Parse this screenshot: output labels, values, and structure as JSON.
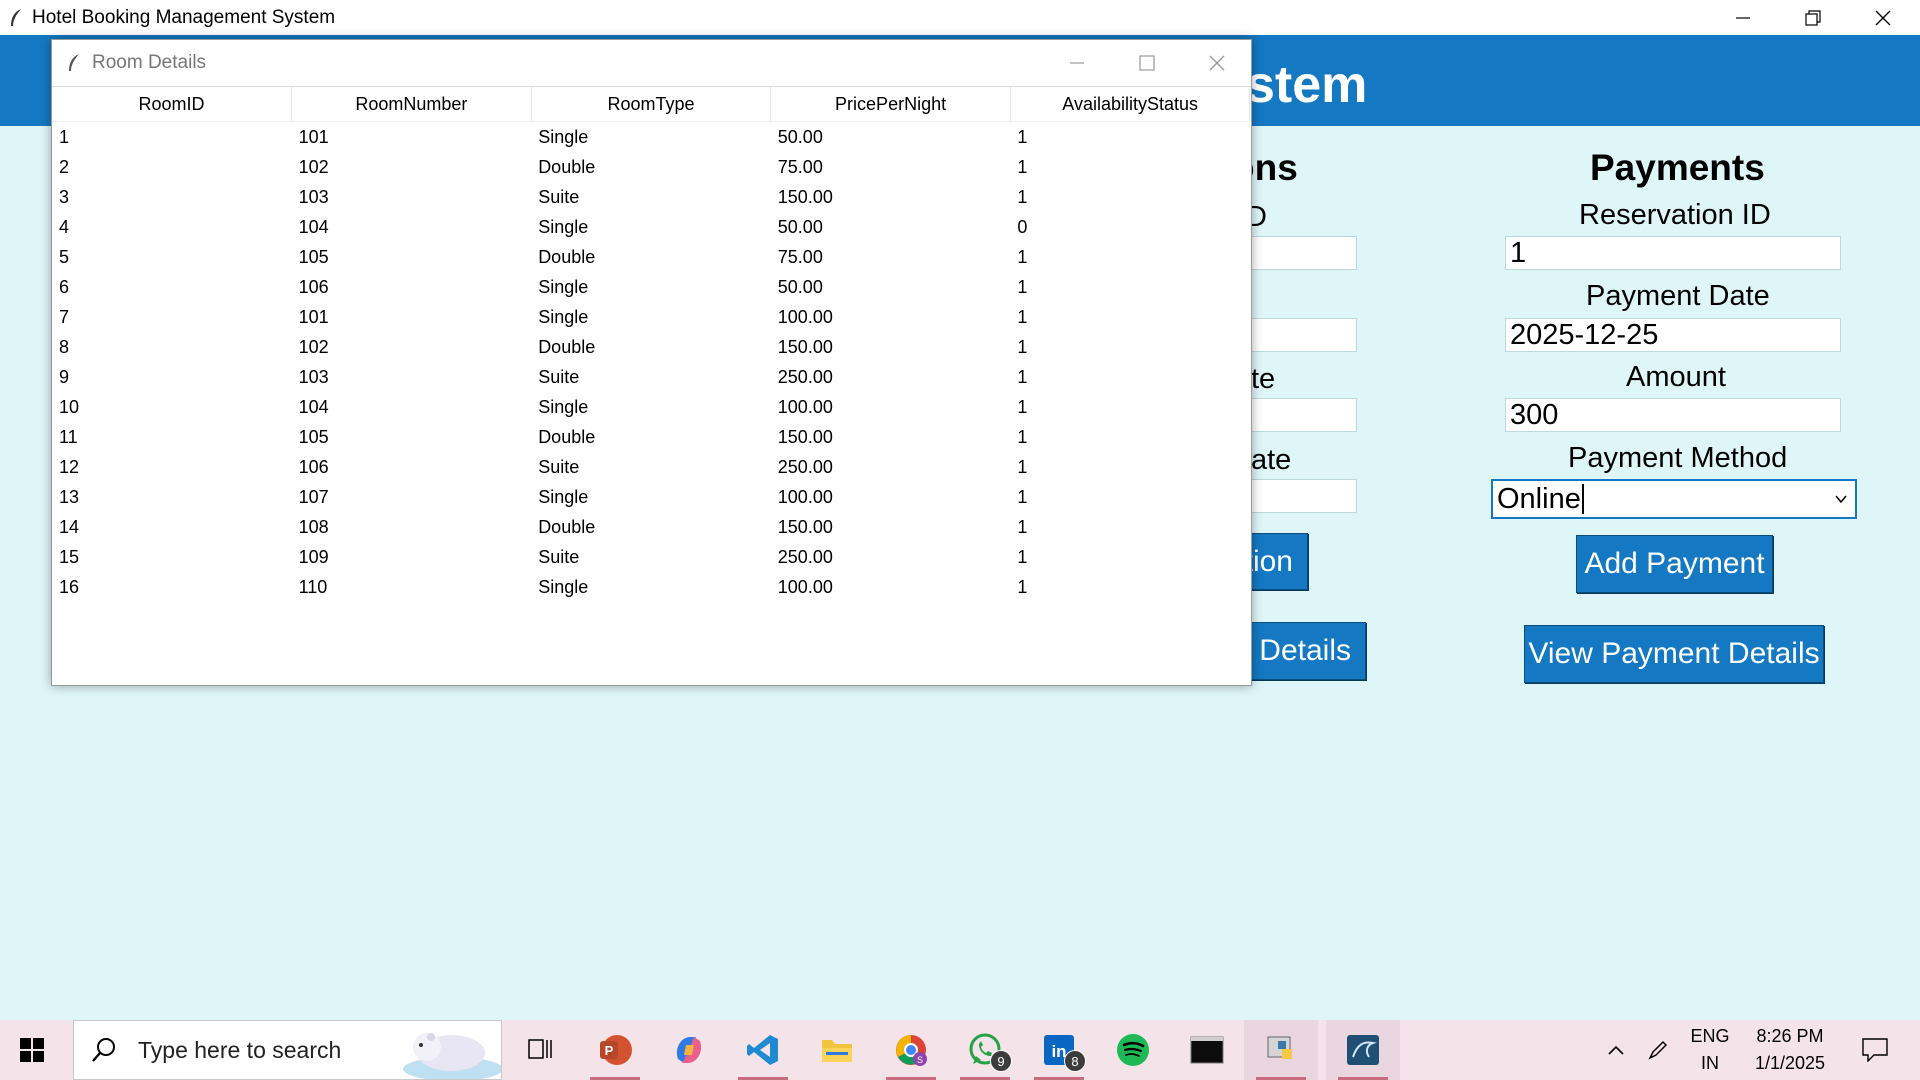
{
  "window": {
    "title": "Hotel Booking Management System",
    "controls": [
      "minimize-icon",
      "restore-icon",
      "close-icon"
    ]
  },
  "banner": {
    "title_fragment": "stem"
  },
  "reservations_section": {
    "heading_fragment": "ons",
    "label_fragments": [
      "D",
      "te",
      "ate"
    ],
    "button_fragments": [
      "tion",
      "s Details"
    ]
  },
  "payments": {
    "heading": "Payments",
    "reservation_id_label": "Reservation ID",
    "reservation_id_value": "1",
    "payment_date_label": "Payment Date",
    "payment_date_value": "2025-12-25",
    "amount_label": "Amount",
    "amount_value": "300",
    "method_label": "Payment Method",
    "method_value": "Online",
    "add_button": "Add Payment",
    "view_button": "View Payment Details"
  },
  "room_dialog": {
    "title": "Room Details",
    "columns": [
      "RoomID",
      "RoomNumber",
      "RoomType",
      "PricePerNight",
      "AvailabilityStatus"
    ],
    "rows": [
      [
        "1",
        "101",
        "Single",
        "50.00",
        "1"
      ],
      [
        "2",
        "102",
        "Double",
        "75.00",
        "1"
      ],
      [
        "3",
        "103",
        "Suite",
        "150.00",
        "1"
      ],
      [
        "4",
        "104",
        "Single",
        "50.00",
        "0"
      ],
      [
        "5",
        "105",
        "Double",
        "75.00",
        "1"
      ],
      [
        "6",
        "106",
        "Single",
        "50.00",
        "1"
      ],
      [
        "7",
        "101",
        "Single",
        "100.00",
        "1"
      ],
      [
        "8",
        "102",
        "Double",
        "150.00",
        "1"
      ],
      [
        "9",
        "103",
        "Suite",
        "250.00",
        "1"
      ],
      [
        "10",
        "104",
        "Single",
        "100.00",
        "1"
      ],
      [
        "11",
        "105",
        "Double",
        "150.00",
        "1"
      ],
      [
        "12",
        "106",
        "Suite",
        "250.00",
        "1"
      ],
      [
        "13",
        "107",
        "Single",
        "100.00",
        "1"
      ],
      [
        "14",
        "108",
        "Double",
        "150.00",
        "1"
      ],
      [
        "15",
        "109",
        "Suite",
        "250.00",
        "1"
      ],
      [
        "16",
        "110",
        "Single",
        "100.00",
        "1"
      ]
    ]
  },
  "taskbar": {
    "search_placeholder": "Type here to search",
    "apps": [
      {
        "name": "task-view-icon"
      },
      {
        "name": "powerpoint-icon"
      },
      {
        "name": "copilot-icon"
      },
      {
        "name": "vscode-icon"
      },
      {
        "name": "file-explorer-icon"
      },
      {
        "name": "chrome-icon"
      },
      {
        "name": "whatsapp-icon",
        "badge": "9"
      },
      {
        "name": "linkedin-icon",
        "badge": "8"
      },
      {
        "name": "spotify-icon"
      },
      {
        "name": "terminal-icon"
      },
      {
        "name": "python-icon"
      },
      {
        "name": "mysql-workbench-icon"
      }
    ],
    "language_line1": "ENG",
    "language_line2": "IN",
    "time": "8:26 PM",
    "date": "1/1/2025"
  },
  "colors": {
    "banner": "#1478c2",
    "app_background": "#dff6f8",
    "button": "#1478c2",
    "taskbar": "#f4e4ea"
  }
}
